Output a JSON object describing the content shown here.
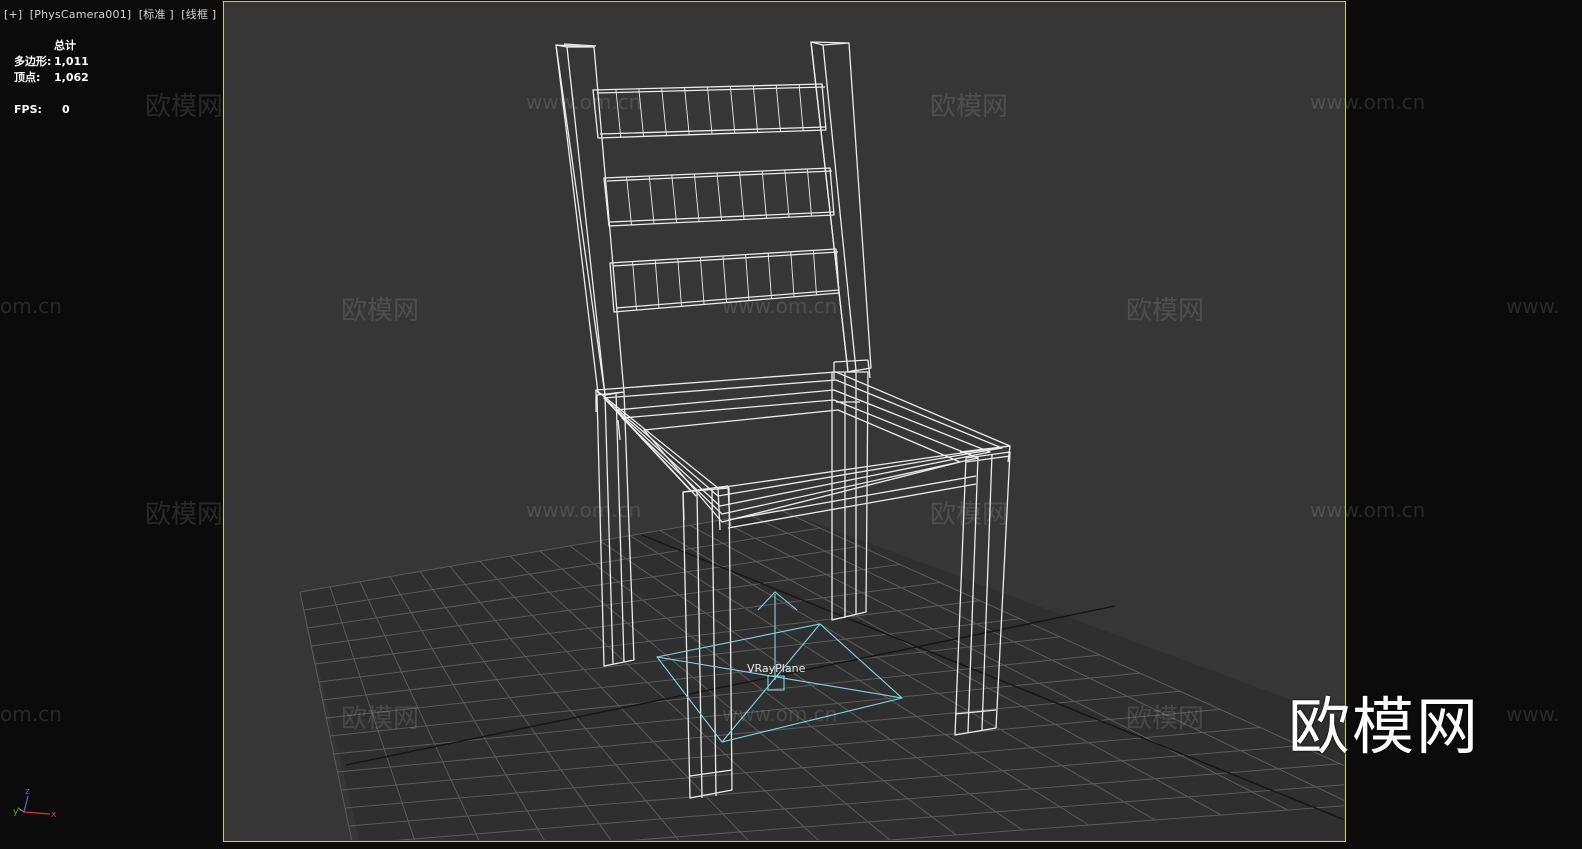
{
  "viewport": {
    "label": "[+]  [PhysCamera001]  [标准 ]  [线框 ]"
  },
  "stats": {
    "header": "总计",
    "polygons_label": "多边形:",
    "polygons_value": "1,011",
    "vertices_label": "顶点:",
    "vertices_value": "1,062",
    "fps_label": "FPS:",
    "fps_value": "0"
  },
  "scene": {
    "object_label": "VRayPlane"
  },
  "watermark": {
    "brand": "欧模网",
    "brand_dim": "欧模网",
    "url": "www.om.cn",
    "url_partial_left": "om.cn",
    "url_partial_right": "www."
  },
  "gizmo": {
    "x": "x",
    "y": "y",
    "z": "z"
  },
  "colors": {
    "viewport_bg": "#363636",
    "safe_frame": "#d9c93a",
    "wireframe": "#ececec",
    "grid": "#5f5f5f",
    "vrayplane": "#7fd6e6"
  }
}
